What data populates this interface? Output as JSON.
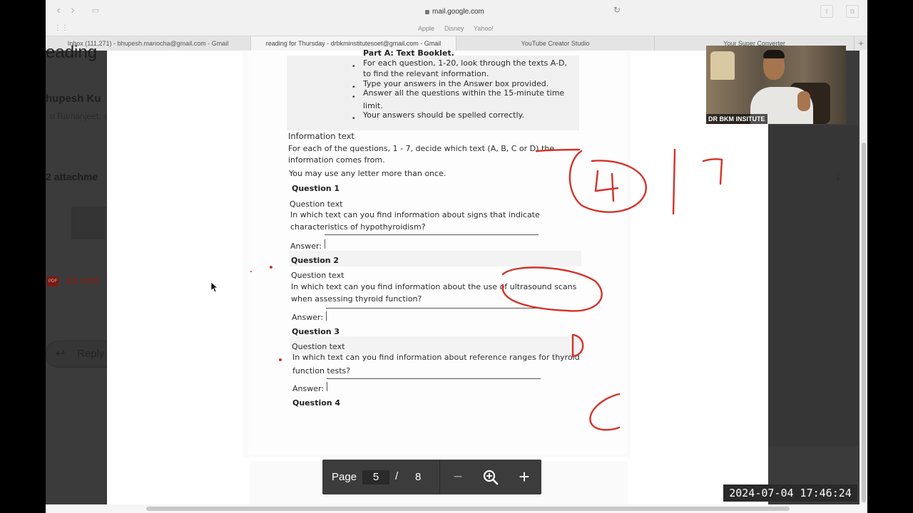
{
  "browser": {
    "url": "mail.google.com",
    "favorites": [
      "Apple",
      "Disney",
      "Yahoo!"
    ],
    "tabs": [
      {
        "label": "Inbox (111,271) - bhupesh.manocha@gmail.com - Gmail",
        "active": false
      },
      {
        "label": "reading for Thursday - drbkminstitutesoet@gmail.com - Gmail",
        "active": true
      },
      {
        "label": "YouTube Creator Studio",
        "active": false
      },
      {
        "label": "Your Super Converter",
        "active": false
      }
    ],
    "new_tab_symbol": "+"
  },
  "gmail": {
    "subject_partial": "eading",
    "sender_partial": "hupesh Ku",
    "to_partial": "o Ramanjeet, s",
    "attachments_partial": "2 attachme",
    "attachment_name_partial": "33) CAN",
    "pdf_chip": "PDF",
    "reply_label": "Reply"
  },
  "pdf": {
    "part_title": "Part A: Text Booklet.",
    "instructions": [
      "For each question, 1-20, look through the texts A-D,",
      "to find the relevant information.",
      "Type your answers in the Answer box provided.",
      "Answer all the questions within the 15-minute time",
      "limit.",
      "Your answers should be spelled correctly."
    ],
    "info_heading": "Information text",
    "info_line1": "For each of the questions, 1 - 7, decide which text (A, B, C or D) the",
    "info_line2": "information comes from.",
    "info_line3": "You may use any letter more than once.",
    "questions": [
      {
        "title": "Question 1",
        "sub": "Question text",
        "line1": "In which text can you find information about signs that indicate",
        "line2": "characteristics of hypothyroidism?",
        "answer_label": "Answer:"
      },
      {
        "title": "Question 2",
        "sub": "Question text",
        "line1": "In which text can you find information about the use of ultrasound scans",
        "line2": "when assessing thyroid function?",
        "answer_label": "Answer:"
      },
      {
        "title": "Question 3",
        "sub": "Question text",
        "line1": "In which text can you find information about reference ranges for thyroid",
        "line2": "function tests?",
        "answer_label": "Answer:"
      },
      {
        "title": "Question 4"
      }
    ],
    "toolbar": {
      "page_label": "Page",
      "current_page": "5",
      "separator": "/",
      "total_pages": "8"
    }
  },
  "annotations": {
    "circled_number": "4",
    "right_number": "7",
    "letter_d": "D",
    "letter_c": "C",
    "color": "#d4322a"
  },
  "webcam": {
    "label": "DR BKM INSITUTE"
  },
  "timestamp": "2024-07-04 17:46:24"
}
